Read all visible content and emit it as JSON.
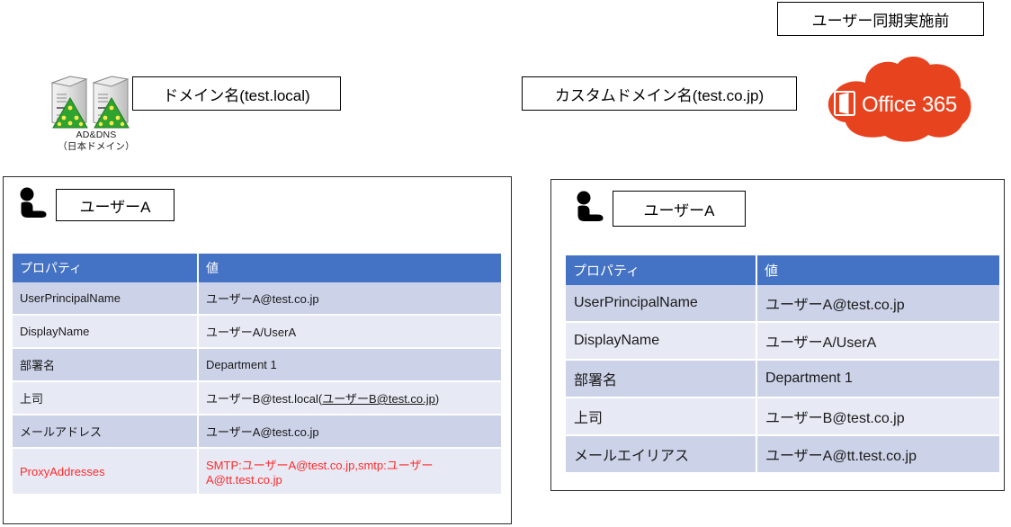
{
  "diagram": {
    "sync_state_label": "ユーザー同期実施前",
    "onprem_domain_label": "ドメイン名(test.local)",
    "custom_domain_label": "カスタムドメイン名(test.co.jp)",
    "server_caption_line1": "AD&DNS",
    "server_caption_line2": "（日本ドメイン）",
    "office365_wordmark": "Office 365",
    "icons": {
      "server": "server-icon",
      "person": "person-icon",
      "cloud": "cloud-icon",
      "office_doc": "office-document-icon"
    },
    "colors": {
      "table_header": "#4472C4",
      "row_odd": "#CCD2E8",
      "row_even": "#E7EAF5",
      "cloud": "#E8431F",
      "highlight_text": "#FF2A2A",
      "panel_border": "#2b2b2b"
    }
  },
  "onprem_panel": {
    "user_label": "ユーザーA",
    "table": {
      "headers": [
        "プロパティ",
        "値"
      ],
      "rows": [
        {
          "property": "UserPrincipalName",
          "value": "ユーザーA@test.co.jp",
          "highlight": false
        },
        {
          "property": "DisplayName",
          "value": "ユーザーA/UserA",
          "highlight": false
        },
        {
          "property": "部署名",
          "value": "Department 1",
          "highlight": false
        },
        {
          "property": "上司",
          "value": "ユーザーB@test.local(ユーザーB@test.co.jp)",
          "value_plain": "ユーザーB@test.local(",
          "value_underlined": "ユーザーB@test.co.jp",
          "value_tail": ")",
          "highlight": false
        },
        {
          "property": "メールアドレス",
          "value": "ユーザーA@test.co.jp",
          "highlight": false
        },
        {
          "property": "ProxyAddresses",
          "value": "SMTP:ユーザーA@test.co.jp,smtp:ユーザーA@tt.test.co.jp",
          "highlight": true
        }
      ]
    }
  },
  "cloud_panel": {
    "user_label": "ユーザーA",
    "table": {
      "headers": [
        "プロパティ",
        "値"
      ],
      "rows": [
        {
          "property": "UserPrincipalName",
          "value": "ユーザーA@test.co.jp"
        },
        {
          "property": "DisplayName",
          "value": "ユーザーA/UserA"
        },
        {
          "property": "部署名",
          "value": "Department 1"
        },
        {
          "property": "上司",
          "value": "ユーザーB@test.co.jp"
        },
        {
          "property": "メールエイリアス",
          "value": "ユーザーA@tt.test.co.jp"
        }
      ]
    }
  }
}
